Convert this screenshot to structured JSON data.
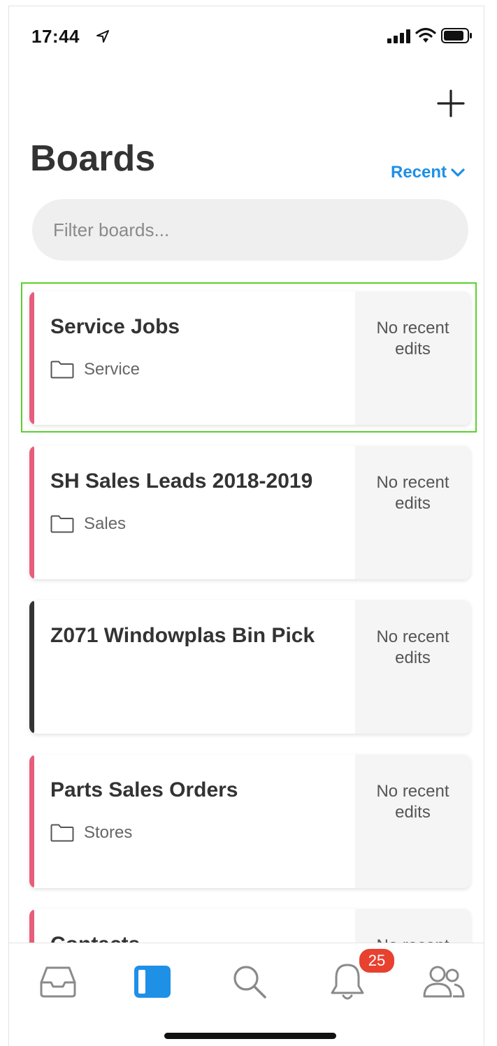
{
  "status_bar": {
    "time": "17:44"
  },
  "header": {
    "title": "Boards",
    "sort_label": "Recent"
  },
  "filter": {
    "placeholder": "Filter boards..."
  },
  "boards": [
    {
      "name": "Service Jobs",
      "folder": "Service",
      "meta": "No recent edits",
      "accent_color": "#e85d7c"
    },
    {
      "name": "SH Sales Leads 2018-2019",
      "folder": "Sales",
      "meta": "No recent edits",
      "accent_color": "#e85d7c"
    },
    {
      "name": "Z071 Windowplas Bin Pick",
      "folder": "",
      "meta": "No recent edits",
      "accent_color": "#333333"
    },
    {
      "name": "Parts Sales Orders",
      "folder": "Stores",
      "meta": "No recent edits",
      "accent_color": "#e85d7c"
    },
    {
      "name": "Contacts",
      "folder": "",
      "meta": "No recent",
      "accent_color": "#e85d7c"
    }
  ],
  "tab_bar": {
    "tabs": [
      {
        "name": "inbox",
        "icon": "inbox-icon",
        "active": false
      },
      {
        "name": "boards",
        "icon": "boards-icon",
        "active": true
      },
      {
        "name": "search",
        "icon": "search-icon",
        "active": false
      },
      {
        "name": "notifications",
        "icon": "bell-icon",
        "active": false
      },
      {
        "name": "team",
        "icon": "people-icon",
        "active": false
      }
    ],
    "notification_count": "25"
  },
  "colors": {
    "accent": "#1e90e6",
    "badge": "#e8412f",
    "selection": "#5ad12e"
  }
}
